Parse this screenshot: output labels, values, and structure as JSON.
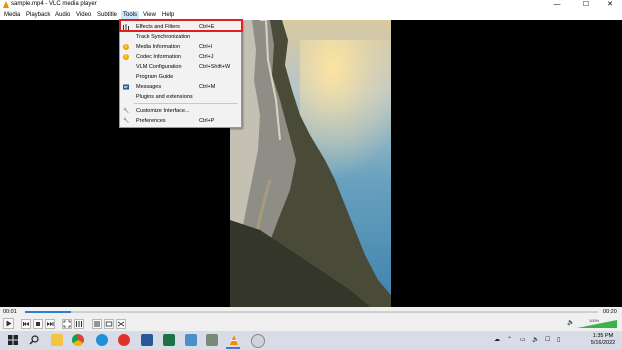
{
  "window": {
    "title": "sample.mp4 - VLC media player",
    "minimize_glyph": "—",
    "maximize_glyph": "☐",
    "close_glyph": "✕"
  },
  "menubar": {
    "items": [
      "Media",
      "Playback",
      "Audio",
      "Video",
      "Subtitle",
      "Tools",
      "View",
      "Help"
    ],
    "active": "Tools"
  },
  "tools_menu": {
    "items": [
      {
        "label": "Effects and Filters",
        "shortcut": "Ctrl+E",
        "icon": "equalizer-icon"
      },
      {
        "label": "Track Synchronization",
        "shortcut": "",
        "icon": ""
      },
      {
        "label": "Media Information",
        "shortcut": "Ctrl+I",
        "icon": "info-icon"
      },
      {
        "label": "Codec Information",
        "shortcut": "Ctrl+J",
        "icon": "info-icon"
      },
      {
        "label": "VLM Configuration",
        "shortcut": "Ctrl+Shift+W",
        "icon": ""
      },
      {
        "label": "Program Guide",
        "shortcut": "",
        "icon": ""
      },
      {
        "label": "Messages",
        "shortcut": "Ctrl+M",
        "icon": "messages-icon"
      },
      {
        "label": "Plugins and extensions",
        "shortcut": "",
        "icon": ""
      },
      {
        "label": "Customize Interface...",
        "shortcut": "",
        "icon": "wrench-icon"
      },
      {
        "label": "Preferences",
        "shortcut": "Ctrl+P",
        "icon": "wrench-icon"
      }
    ],
    "highlighted": "Effects and Filters"
  },
  "player": {
    "elapsed": "00:01",
    "duration": "00:20",
    "progress_fraction": 0.08,
    "volume_label": "100%",
    "volume_fraction": 1.0
  },
  "taskbar": {
    "apps": [
      "search-icon",
      "file-explorer-icon",
      "chrome-icon",
      "edge-icon",
      "opera-icon",
      "word-icon",
      "excel-icon",
      "powershell-icon",
      "notepad-icon",
      "vlc-icon",
      "disk-icon"
    ],
    "active_app": "vlc-icon",
    "clock_time": "1:35 PM",
    "clock_date": "5/16/2022"
  },
  "colors": {
    "accent": "#2a7fd4",
    "highlight_border": "#e02020",
    "vlc_orange": "#f28c00"
  }
}
